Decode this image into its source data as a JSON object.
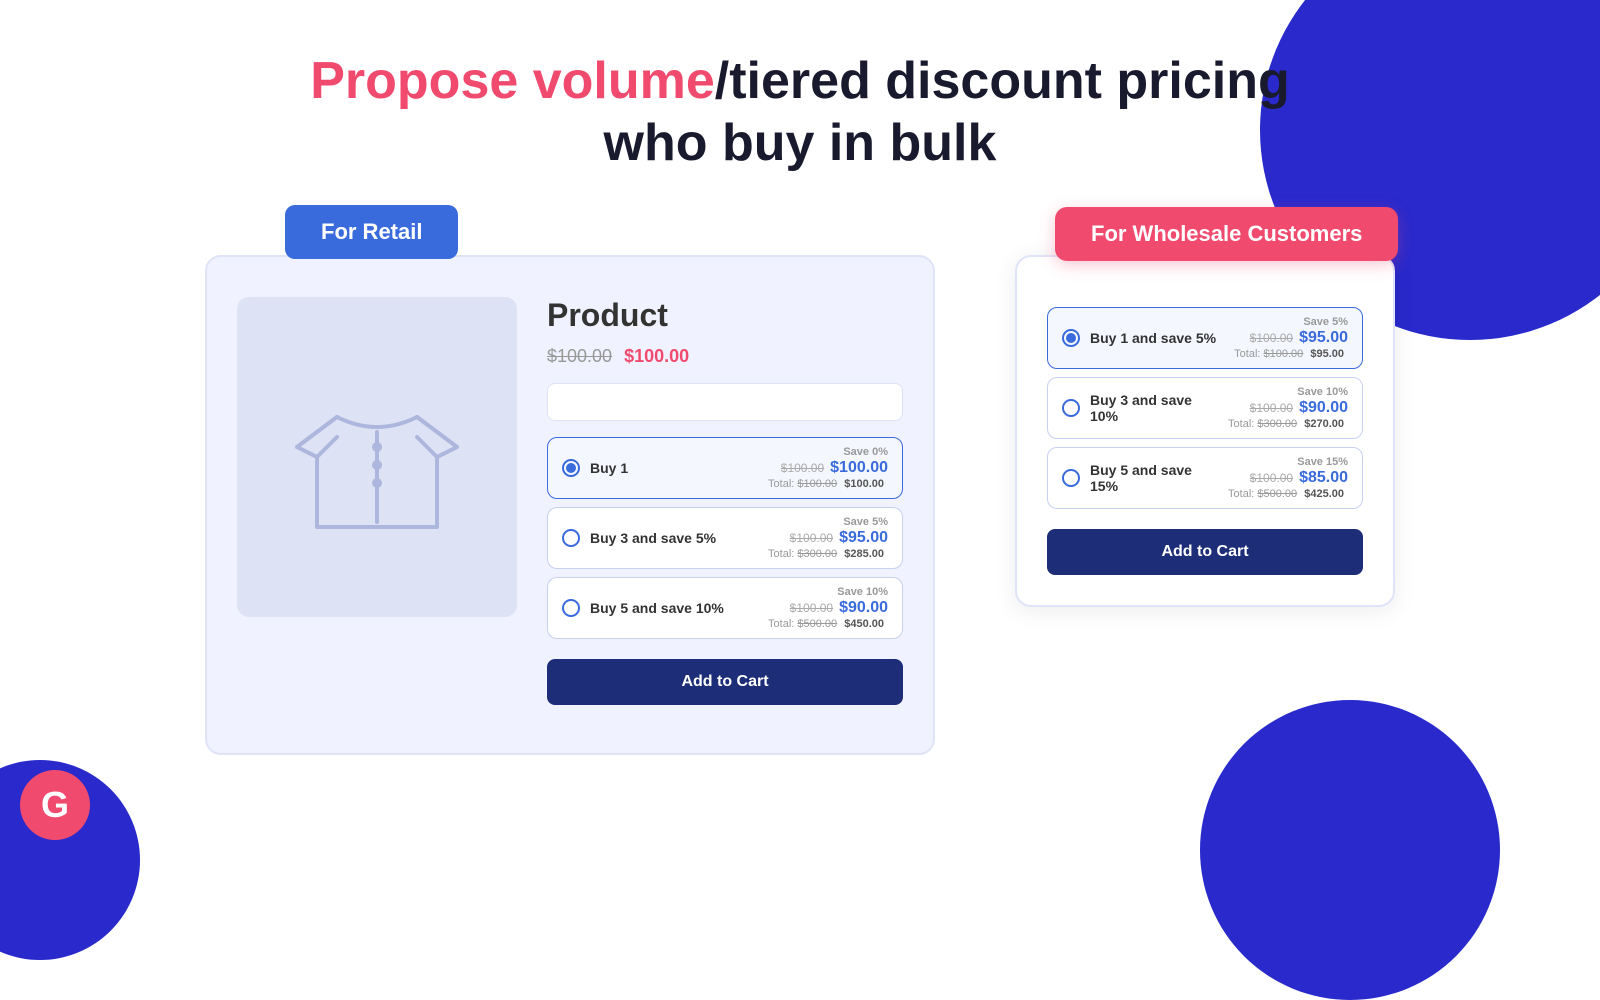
{
  "heading": {
    "part1": "Propose volume",
    "part2": "/tiered discount pricing",
    "line2": "who buy in bulk"
  },
  "retail_badge": "For Retail",
  "wholesale_badge": "For Wholesale Customers",
  "product": {
    "name": "Product",
    "price_original": "$100.00",
    "price_current": "$100.00"
  },
  "retail_tiers": [
    {
      "label": "Buy 1",
      "save": "Save 0%",
      "original": "$100.00",
      "new_price": "$100.00",
      "total_original": "$100.00",
      "total_new": "$100.00",
      "selected": true
    },
    {
      "label": "Buy 3 and save 5%",
      "save": "Save 5%",
      "original": "$100.00",
      "new_price": "$95.00",
      "total_original": "$300.00",
      "total_new": "$285.00",
      "selected": false
    },
    {
      "label": "Buy 5 and save 10%",
      "save": "Save 10%",
      "original": "$100.00",
      "new_price": "$90.00",
      "total_original": "$500.00",
      "total_new": "$450.00",
      "selected": false
    }
  ],
  "retail_add_to_cart": "Add to Cart",
  "wholesale_tiers": [
    {
      "label": "Buy 1 and save 5%",
      "save": "Save 5%",
      "original": "$100.00",
      "new_price": "$95.00",
      "total_original": "$100.00",
      "total_new": "$95.00",
      "selected": true
    },
    {
      "label": "Buy 3 and save 10%",
      "save": "Save 10%",
      "original": "$100.00",
      "new_price": "$90.00",
      "total_original": "$300.00",
      "total_new": "$270.00",
      "selected": false
    },
    {
      "label": "Buy 5 and save 15%",
      "save": "Save 15%",
      "original": "$100.00",
      "new_price": "$85.00",
      "total_original": "$500.00",
      "total_new": "$425.00",
      "selected": false
    }
  ],
  "wholesale_add_to_cart": "Add to Cart",
  "g_logo": "G"
}
